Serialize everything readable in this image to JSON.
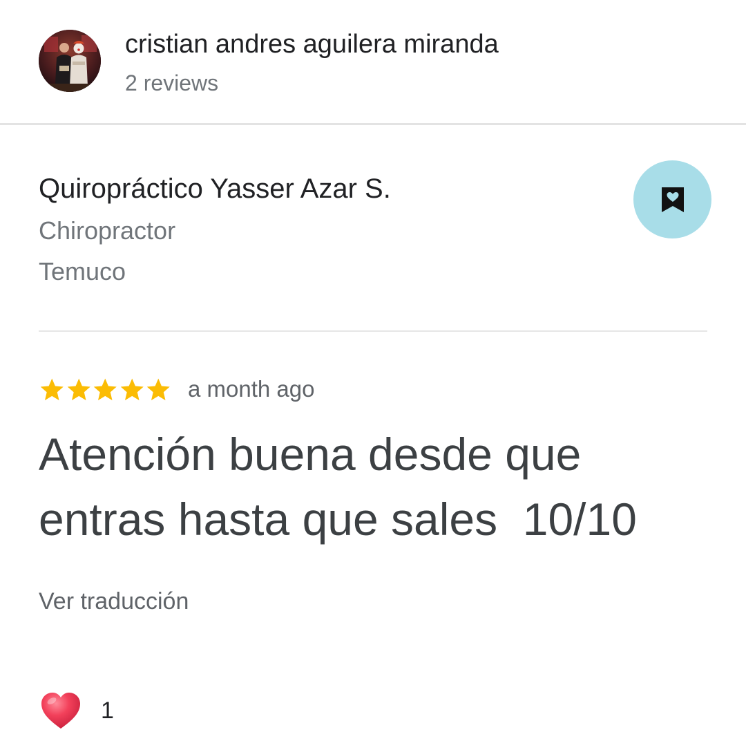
{
  "reviewer": {
    "name": "cristian andres aguilera miranda",
    "review_count": "2 reviews",
    "avatar_icon": "profile-photo"
  },
  "place": {
    "name": "Quiropráctico Yasser Azar S.",
    "category": "Chiropractor",
    "city": "Temuco",
    "save_icon": "bookmark-heart-icon"
  },
  "review": {
    "rating": 5,
    "rating_max": 5,
    "time": "a month ago",
    "text": "Atención buena desde que\nentras hasta que sales  10/10",
    "translate_label": "Ver traducción"
  },
  "reactions": {
    "heart_icon": "heart-icon",
    "like_count": "1"
  },
  "colors": {
    "star": "#fbbc04",
    "save_button_bg": "#a8dde8",
    "heart": "#e8344f",
    "secondary_text": "#70757a",
    "divider": "#e3e3e3"
  }
}
